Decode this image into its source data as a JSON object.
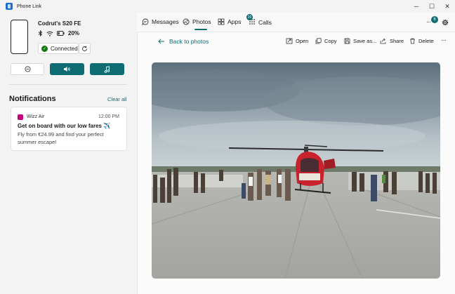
{
  "window": {
    "title": "Phone Link",
    "minimize": "─",
    "maximize": "☐",
    "close": "✕"
  },
  "device": {
    "name": "Codrut's S20 FE",
    "battery": "20%",
    "connection_label": "Connected"
  },
  "notifications": {
    "title": "Notifications",
    "clear_label": "Clear all",
    "items": [
      {
        "app": "Wizz Air",
        "time": "12:00 PM",
        "heading": "Get on board with our low fares ✈️",
        "body": "Fly from €24.99 and find your perfect summer escape!"
      }
    ]
  },
  "tabs": [
    {
      "label": "Messages",
      "icon": "message-icon"
    },
    {
      "label": "Photos",
      "icon": "photo-icon",
      "active": true
    },
    {
      "label": "Apps",
      "icon": "apps-grid-icon"
    },
    {
      "label": "Calls",
      "icon": "dialpad-icon",
      "badge": "20"
    }
  ],
  "top_right": {
    "more_badge": "6"
  },
  "photo_view": {
    "back_label": "Back to photos",
    "actions": [
      "Open",
      "Copy",
      "Save as...",
      "Share",
      "Delete"
    ]
  },
  "colors": {
    "accent": "#0e6b72",
    "connected_green": "#0f7b0f",
    "wizz_brand": "#c6007e",
    "helicopter_red": "#c8232c"
  }
}
